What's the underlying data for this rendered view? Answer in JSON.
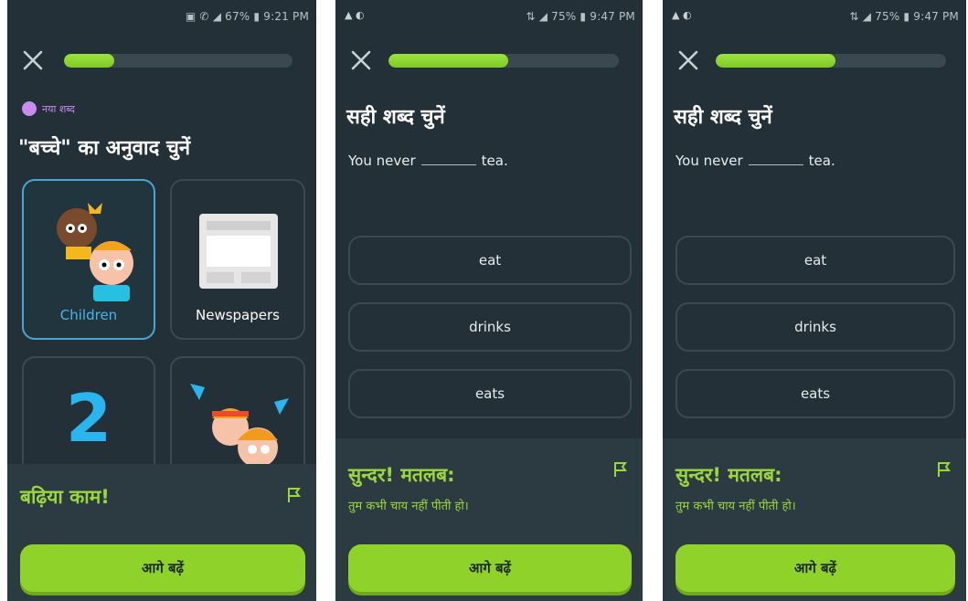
{
  "screens": [
    {
      "status": {
        "left": "",
        "right": "▣ ✆ ◢ 67% ▮ 9:21 PM"
      },
      "progress": 0.22,
      "badge": "नया शब्द",
      "prompt": "\"बच्चे\" का अनुवाद चुनें",
      "cards": [
        {
          "label": "Children",
          "selected": true
        },
        {
          "label": "Newspapers",
          "selected": false
        },
        {
          "label": "2",
          "selected": false
        },
        {
          "label": "",
          "selected": false
        }
      ],
      "feedback": {
        "title": "बढ़िया काम!",
        "subtitle": ""
      },
      "continue": "आगे बढ़ें"
    },
    {
      "status": {
        "left": "▲ ◐",
        "right": "⇅ ◢ 75% ▮ 9:47 PM"
      },
      "progress": 0.52,
      "prompt": "सही शब्द चुनें",
      "sentence": {
        "before": "You never",
        "after": "tea."
      },
      "options": [
        "eat",
        "drinks",
        "eats"
      ],
      "feedback": {
        "title": "सुन्दर! मतलब:",
        "subtitle": "तुम कभी चाय नहीं पीती हो।"
      },
      "continue": "आगे बढ़ें"
    },
    {
      "status": {
        "left": "▲ ◐",
        "right": "⇅ ◢ 75% ▮ 9:47 PM"
      },
      "progress": 0.52,
      "prompt": "सही शब्द चुनें",
      "sentence": {
        "before": "You never",
        "after": "tea."
      },
      "options": [
        "eat",
        "drinks",
        "eats"
      ],
      "feedback": {
        "title": "सुन्दर! मतलब:",
        "subtitle": "तुम कभी चाय नहीं पीती हो।"
      },
      "continue": "आगे बढ़ें"
    }
  ],
  "colors": {
    "bg": "#233037",
    "accent": "#8fd32a",
    "select": "#4aa5d6",
    "badge": "#c98bf0"
  }
}
